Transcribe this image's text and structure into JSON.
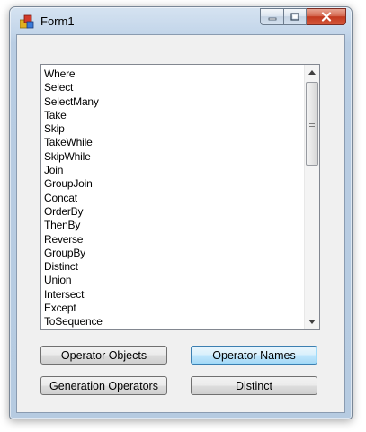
{
  "window": {
    "title": "Form1",
    "icon": "winforms-app-icon",
    "caption_buttons": {
      "minimize": "minimize-icon",
      "maximize": "maximize-icon",
      "close": "close-icon"
    }
  },
  "listbox": {
    "items": [
      "Where",
      "Select",
      "SelectMany",
      "Take",
      "Skip",
      "TakeWhile",
      "SkipWhile",
      "Join",
      "GroupJoin",
      "Concat",
      "OrderBy",
      "ThenBy",
      "Reverse",
      "GroupBy",
      "Distinct",
      "Union",
      "Intersect",
      "Except",
      "ToSequence"
    ],
    "scroll_thumb_position": 0
  },
  "buttons": {
    "operator_objects": "Operator Objects",
    "operator_names": "Operator Names",
    "generation_operators": "Generation Operators",
    "distinct": "Distinct"
  },
  "colors": {
    "window_frame": "#b9cde3",
    "client_background": "#f0f0f0",
    "close_button": "#c2391f",
    "default_button_accent": "#3c7fb1"
  }
}
